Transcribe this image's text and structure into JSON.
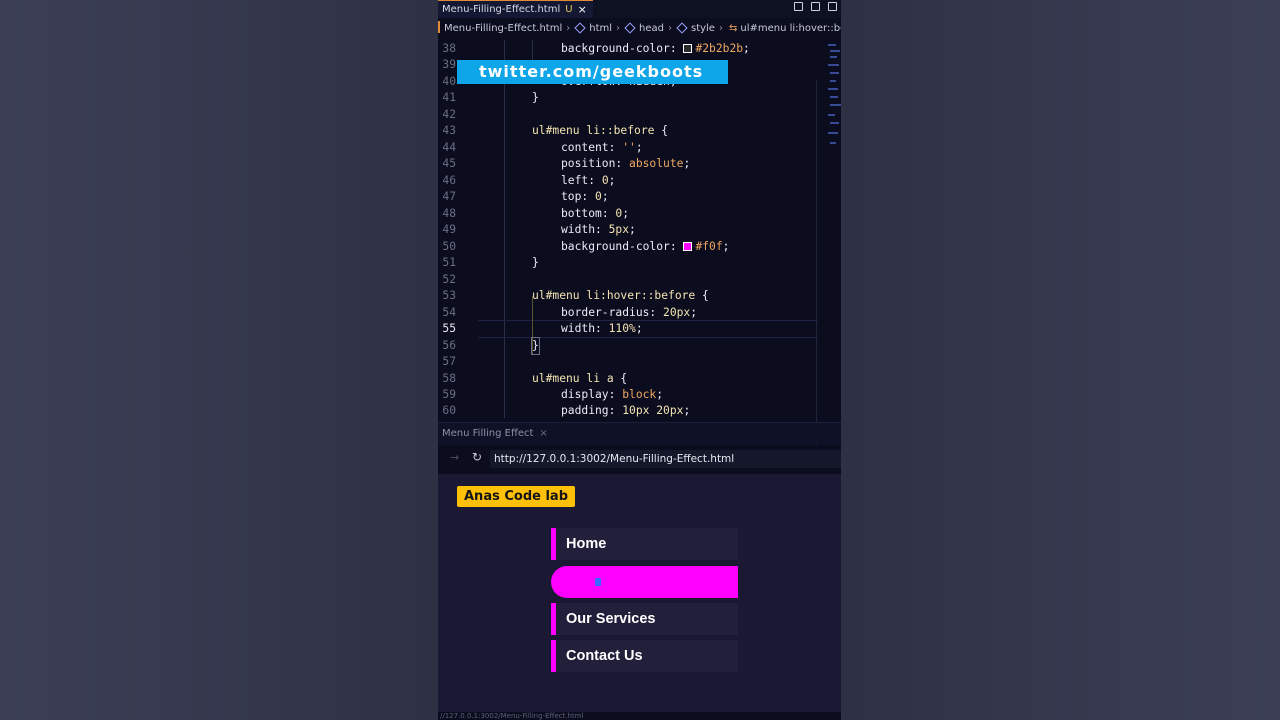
{
  "editor_tab": {
    "filename": "Menu-Filling-Effect.html",
    "modified": "U",
    "close": "×"
  },
  "breadcrumb": [
    "Menu-Filling-Effect.html",
    "html",
    "head",
    "style",
    "ul#menu li:hover::bef"
  ],
  "code": {
    "l38": {
      "n": "38",
      "prop": "background-color",
      "val": "#2b2b2b",
      "swatch": "#2b2b2b"
    },
    "l39": {
      "n": "39"
    },
    "l40": {
      "n": "40",
      "text": "overflow: hidden;"
    },
    "l41": {
      "n": "41",
      "text": "}"
    },
    "l42": {
      "n": "42"
    },
    "l43": {
      "n": "43",
      "sel": "ul#menu li::before",
      "open": " {"
    },
    "l44": {
      "n": "44",
      "prop": "content",
      "val": "''"
    },
    "l45": {
      "n": "45",
      "prop": "position",
      "val": "absolute"
    },
    "l46": {
      "n": "46",
      "prop": "left",
      "val": "0"
    },
    "l47": {
      "n": "47",
      "prop": "top",
      "val": "0"
    },
    "l48": {
      "n": "48",
      "prop": "bottom",
      "val": "0"
    },
    "l49": {
      "n": "49",
      "prop": "width",
      "val": "5px"
    },
    "l50": {
      "n": "50",
      "prop": "background-color",
      "val": "#f0f",
      "swatch": "#ff00ff"
    },
    "l51": {
      "n": "51",
      "text": "}"
    },
    "l52": {
      "n": "52"
    },
    "l53": {
      "n": "53",
      "sel": "ul#menu li:hover::before",
      "open": " {"
    },
    "l54": {
      "n": "54",
      "prop": "border-radius",
      "val": "20px"
    },
    "l55": {
      "n": "55",
      "prop": "width",
      "val": "110%"
    },
    "l56": {
      "n": "56",
      "text": "}"
    },
    "l57": {
      "n": "57"
    },
    "l58": {
      "n": "58",
      "sel": "ul#menu li a",
      "open": " {"
    },
    "l59": {
      "n": "59",
      "prop": "display",
      "val": "block"
    },
    "l60": {
      "n": "60",
      "prop": "padding",
      "val": "10px 20px"
    }
  },
  "banner": {
    "text": "twitter.com/geekboots"
  },
  "preview": {
    "tab_title": "Menu Filling Effect",
    "tab_close": "×",
    "url": "http://127.0.0.1:3002/Menu-Filling-Effect.html",
    "badge": "Anas Code lab",
    "menu": [
      "Home",
      "",
      "Our Services",
      "Contact Us"
    ],
    "status_url": "//127.0.0.1:3002/Menu-Filling-Effect.html"
  },
  "colors": {
    "accent": "#ff00ff",
    "badge": "#ffc107",
    "banner": "#0ea5e9"
  }
}
